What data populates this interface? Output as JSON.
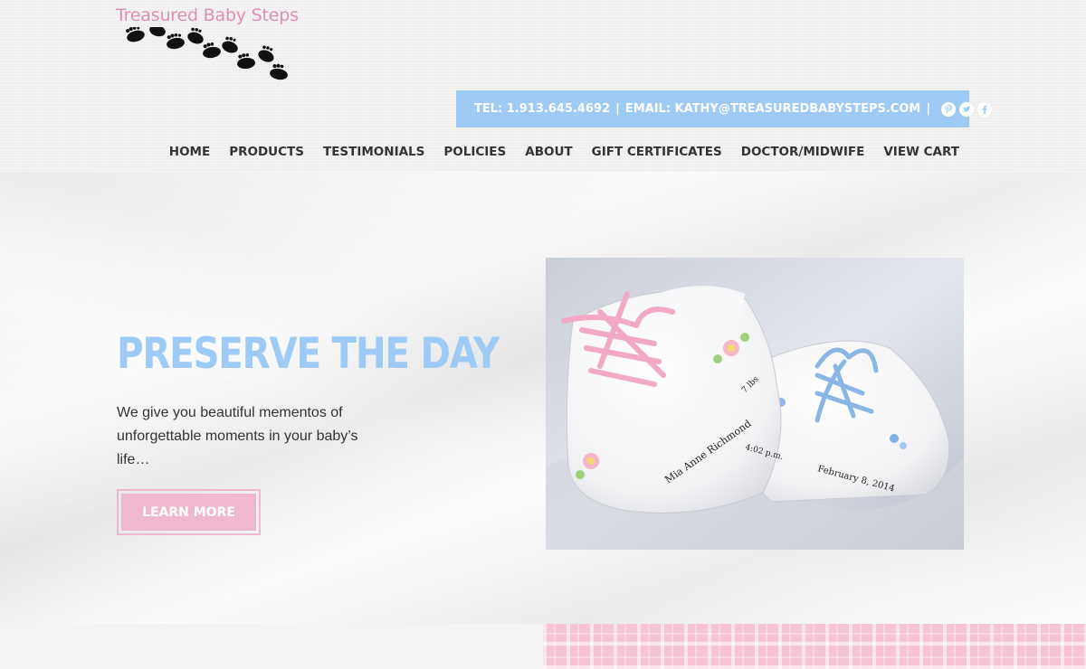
{
  "brand": {
    "name": "Treasured Baby Steps",
    "color": "#e08fb6"
  },
  "contact": {
    "tel": "TEL: 1.913.645.4692",
    "separator": "|",
    "email": "EMAIL: KATHY@TREASUREDBABYSTEPS.COM",
    "social_icons": [
      "pinterest-icon",
      "twitter-icon",
      "facebook-icon"
    ],
    "bar_color": "#9ecbf5"
  },
  "nav": {
    "items": [
      "HOME",
      "PRODUCTS",
      "TESTIMONIALS",
      "POLICIES",
      "ABOUT",
      "GIFT CERTIFICATES",
      "DOCTOR/MIDWIFE",
      "VIEW CART"
    ]
  },
  "hero": {
    "title": "PRESERVE THE DAY",
    "text": "We give you beautiful mementos of unforgettable moments in your baby’s life…",
    "button_label": "LEARN MORE",
    "title_color": "#9ecbf5",
    "button_color": "#f0b8cf",
    "photo": {
      "shoe_name": "Mia Anne Richmond",
      "weight": "7 lbs",
      "time": "4:02 p.m.",
      "date": "February 8, 2014"
    }
  }
}
